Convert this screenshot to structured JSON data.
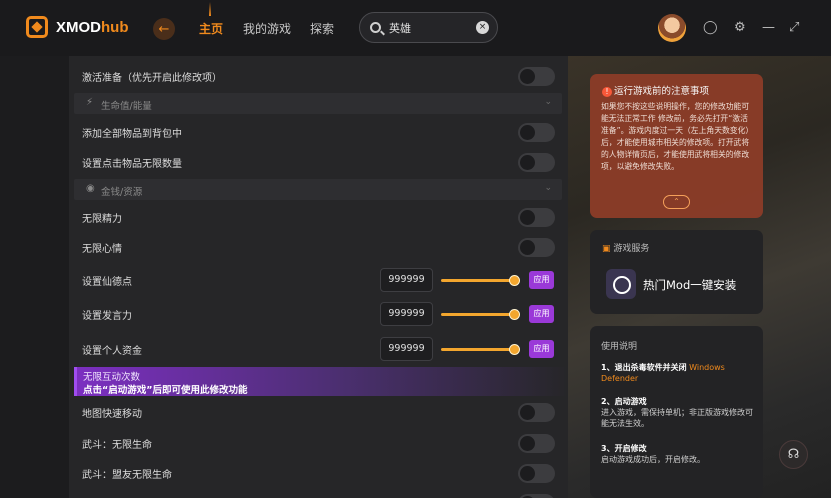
{
  "app": {
    "name_main": "XMOD",
    "name_suffix": "hub"
  },
  "nav": {
    "back_icon": "arrow-left-icon",
    "tabs": [
      {
        "label": "主页",
        "active": true
      },
      {
        "label": "我的游戏",
        "active": false
      },
      {
        "label": "探索",
        "active": false
      }
    ]
  },
  "search": {
    "value": "英雄"
  },
  "window_controls": [
    "coin-icon",
    "settings-icon",
    "minimize-icon",
    "collapse-icon"
  ],
  "mods": {
    "rows": [
      {
        "label": "激活准备（优先开启此修改项）",
        "type": "toggle"
      },
      {
        "label": "生命值/能量",
        "type": "section",
        "icon": "bolt-icon"
      },
      {
        "label": "添加全部物品到背包中",
        "type": "toggle"
      },
      {
        "label": "设置点击物品无限数量",
        "type": "toggle"
      },
      {
        "label": "金钱/资源",
        "type": "section",
        "icon": "coins-icon"
      },
      {
        "label": "无限精力",
        "type": "toggle"
      },
      {
        "label": "无限心情",
        "type": "toggle"
      },
      {
        "label": "设置仙德点",
        "type": "input",
        "value": "999999",
        "slider": 1.0,
        "button": "应用"
      },
      {
        "label": "设置发言力",
        "type": "input",
        "value": "999999",
        "slider": 1.0,
        "button": "应用"
      },
      {
        "label": "设置个人资金",
        "type": "input",
        "value": "999999",
        "slider": 1.0,
        "button": "应用"
      }
    ],
    "banner": {
      "line1": "无限互动次数",
      "line2": "点击“启动游戏”后即可使用此修改功能"
    },
    "rows_after": [
      {
        "label": "地图快速移动",
        "type": "toggle"
      },
      {
        "label": "武斗：无限生命",
        "type": "toggle"
      },
      {
        "label": "武斗：盟友无限生命",
        "type": "toggle"
      }
    ]
  },
  "notice": {
    "title": "运行游戏前的注意事项",
    "body": "如果您不按这些说明操作，您的修改功能可能无法正常工作 修改前，务必先打开“激活准备”。游戏内度过一天（左上角天数变化）后，才能使用城市相关的修改项。打开武将的人物详情页后，才能使用武将相关的修改项，以避免修改失败。",
    "expand_icon": "chevron-up-icon"
  },
  "game_service": {
    "title": "游戏服务",
    "item": "热门Mod一键安装"
  },
  "instructions": {
    "title": "使用说明",
    "items": [
      {
        "heading": "1、退出杀毒软件并关闭",
        "highlight": "Windows Defender",
        "text": ""
      },
      {
        "heading": "2、启动游戏",
        "highlight": "",
        "text": "进入游戏，需保持单机；非正版游戏修改可能无法生效。"
      },
      {
        "heading": "3、开启修改",
        "highlight": "",
        "text": "启动游戏成功后，开启修改。"
      }
    ]
  }
}
